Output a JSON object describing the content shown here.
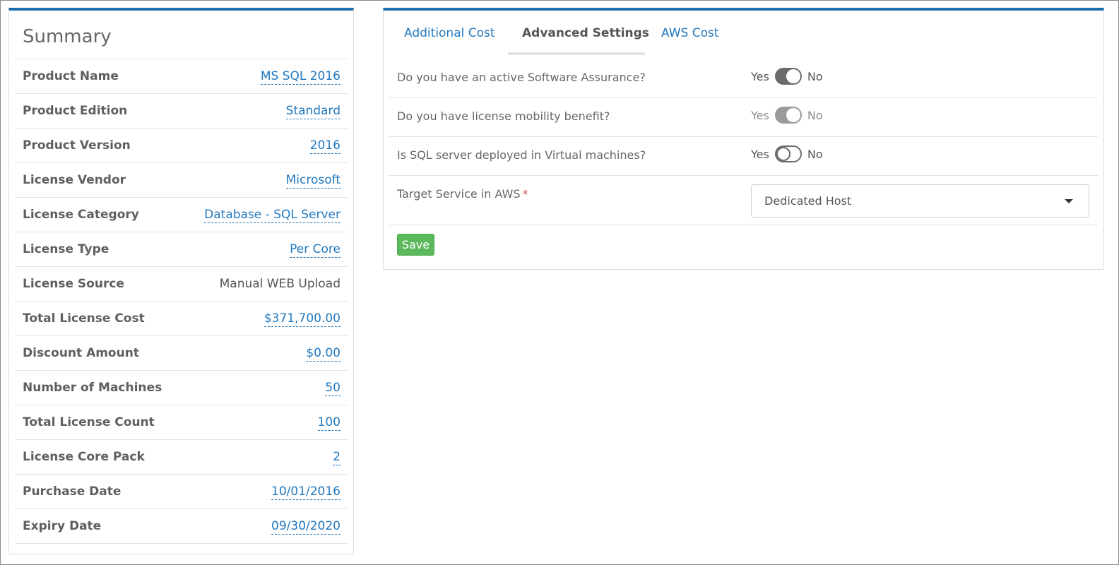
{
  "summary": {
    "title": "Summary",
    "rows": [
      {
        "label": "Product Name",
        "value": "MS SQL 2016",
        "editable": true
      },
      {
        "label": "Product Edition",
        "value": "Standard",
        "editable": true
      },
      {
        "label": "Product Version",
        "value": "2016",
        "editable": true
      },
      {
        "label": "License Vendor",
        "value": "Microsoft",
        "editable": true
      },
      {
        "label": "License Category",
        "value": "Database - SQL Server",
        "editable": true
      },
      {
        "label": "License Type",
        "value": "Per Core",
        "editable": true
      },
      {
        "label": "License Source",
        "value": "Manual WEB Upload",
        "editable": false
      },
      {
        "label": "Total License Cost",
        "value": "$371,700.00",
        "editable": true
      },
      {
        "label": "Discount Amount",
        "value": "$0.00",
        "editable": true
      },
      {
        "label": "Number of Machines",
        "value": "50",
        "editable": true
      },
      {
        "label": "Total License Count",
        "value": "100",
        "editable": true
      },
      {
        "label": "License Core Pack",
        "value": "2",
        "editable": true
      },
      {
        "label": "Purchase Date",
        "value": "10/01/2016",
        "editable": true
      },
      {
        "label": "Expiry Date",
        "value": "09/30/2020",
        "editable": true
      }
    ]
  },
  "tabs": [
    {
      "label": "Additional Cost",
      "active": false
    },
    {
      "label": "Advanced Settings",
      "active": true
    },
    {
      "label": "AWS Cost",
      "active": false
    }
  ],
  "settings": {
    "software_assurance": {
      "question": "Do you have an active Software Assurance?",
      "yes": "Yes",
      "no": "No",
      "value": "yes"
    },
    "license_mobility": {
      "question": "Do you have license mobility benefit?",
      "yes": "Yes",
      "no": "No",
      "value": "yes",
      "disabled": true
    },
    "virtual_machines": {
      "question": "Is SQL server deployed in Virtual machines?",
      "yes": "Yes",
      "no": "No",
      "value": "no"
    },
    "target_service": {
      "label": "Target Service in AWS",
      "required_mark": "*",
      "selected": "Dedicated Host"
    },
    "save_label": "Save"
  },
  "colors": {
    "accent": "#1e6fae",
    "link": "#2178c0",
    "save": "#5cb85c",
    "required": "#e0504d"
  }
}
